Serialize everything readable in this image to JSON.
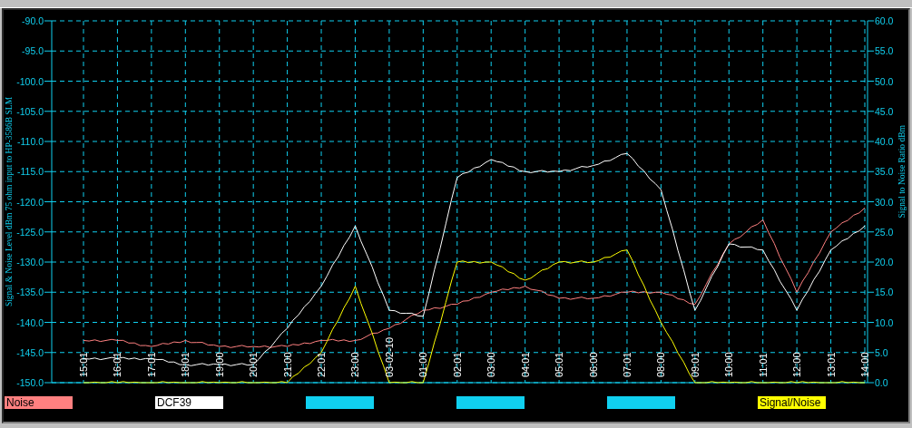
{
  "chart": {
    "chart_data": {
      "type": "line",
      "grid": true,
      "ylabel": "Signal & Noise Level  dBm 75 ohm input to HP-3586B SLM",
      "y2label": "Signal to Noise Ratio  dBm",
      "categories": [
        "15:01",
        "16:01",
        "17:01",
        "18:01",
        "19:00",
        "20:01",
        "21:00",
        "22:01",
        "23:00",
        "03-02-10",
        "01:00",
        "02:01",
        "03:00",
        "04:01",
        "05:01",
        "06:00",
        "07:01",
        "08:00",
        "09:01",
        "10:00",
        "11:01",
        "12:00",
        "13:01",
        "14:00"
      ],
      "ylim": [
        -150,
        -90
      ],
      "yticks": [
        {
          "value": -150,
          "label": "-150.0"
        },
        {
          "value": -145,
          "label": "-145.0"
        },
        {
          "value": -140,
          "label": "-140.0"
        },
        {
          "value": -135,
          "label": "-135.0"
        },
        {
          "value": -130,
          "label": "-130.0"
        },
        {
          "value": -125,
          "label": "-125.0"
        },
        {
          "value": -120,
          "label": "-120.0"
        },
        {
          "value": -115,
          "label": "-115.0"
        },
        {
          "value": -110,
          "label": "-110.0"
        },
        {
          "value": -105,
          "label": "-105.0"
        },
        {
          "value": -100,
          "label": "-100.0"
        },
        {
          "value": -95,
          "label": "-95.0"
        },
        {
          "value": -90,
          "label": "-90.0"
        }
      ],
      "y2lim": [
        0,
        60
      ],
      "y2ticks": [
        {
          "value": 0,
          "label": "0.0"
        },
        {
          "value": 5,
          "label": "5.0"
        },
        {
          "value": 10,
          "label": "10.0"
        },
        {
          "value": 15,
          "label": "15.0"
        },
        {
          "value": 20,
          "label": "20.0"
        },
        {
          "value": 25,
          "label": "25.0"
        },
        {
          "value": 30,
          "label": "30.0"
        },
        {
          "value": 35,
          "label": "35.0"
        },
        {
          "value": 40,
          "label": "40.0"
        },
        {
          "value": 45,
          "label": "45.0"
        },
        {
          "value": 50,
          "label": "50.0"
        },
        {
          "value": 55,
          "label": "55.0"
        },
        {
          "value": 60,
          "label": "60.0"
        }
      ],
      "series": [
        {
          "name": "Noise",
          "color": "#ff8080",
          "values": [
            -143,
            -143,
            -144,
            -143,
            -144,
            -144,
            -144,
            -143,
            -143,
            -141,
            -138,
            -137,
            -135,
            -134,
            -136,
            -136,
            -135,
            -135,
            -137,
            -127,
            -123,
            -135,
            -125,
            -121
          ]
        },
        {
          "name": "DCF39",
          "color": "#ffffff",
          "values": [
            -146,
            -146,
            -146,
            -147,
            -147,
            -147,
            -141,
            -134,
            -124,
            -138,
            -139,
            -116,
            -113,
            -115,
            -115,
            -114,
            -112,
            -118,
            -138,
            -127,
            -128,
            -138,
            -128,
            -124
          ]
        },
        {
          "name": "Signal/Noise",
          "color": "#ffff00",
          "axis": "y2",
          "values": [
            0,
            0,
            0,
            0,
            0,
            0,
            0,
            5,
            16,
            0,
            0,
            20,
            20,
            17,
            20,
            20,
            22,
            10,
            0,
            0,
            0,
            0,
            0,
            0
          ]
        }
      ]
    }
  },
  "legend": [
    {
      "kind": "series"
    },
    {
      "kind": "series"
    },
    {
      "kind": "blank",
      "color": "#10d0f0"
    },
    {
      "kind": "blank",
      "color": "#10d0f0"
    },
    {
      "kind": "blank",
      "color": "#10d0f0"
    },
    {
      "kind": "series"
    }
  ]
}
